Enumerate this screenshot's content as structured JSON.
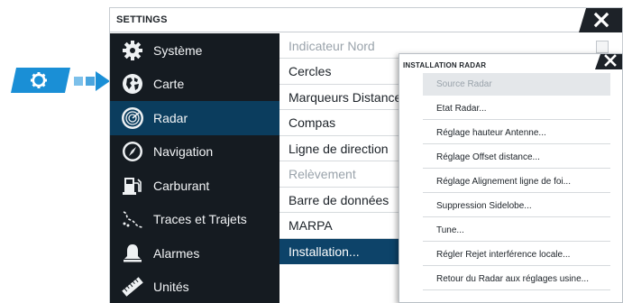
{
  "colors": {
    "accent_blue": "#1a8fd6",
    "sidebar_bg": "#151b21",
    "sidebar_selected": "#0b3d5e",
    "list_active": "#0d4369",
    "close_bg": "#1d2228"
  },
  "badge": {
    "icon": "gear-icon",
    "arrow": "arrow-right-icon"
  },
  "settings": {
    "title": "SETTINGS",
    "close_icon": "close-icon",
    "sidebar": [
      {
        "label": "Système",
        "icon": "gear-icon"
      },
      {
        "label": "Carte",
        "icon": "chart-globe-icon"
      },
      {
        "label": "Radar",
        "icon": "radar-icon",
        "selected": true
      },
      {
        "label": "Navigation",
        "icon": "compass-icon"
      },
      {
        "label": "Carburant",
        "icon": "fuel-pump-icon"
      },
      {
        "label": "Traces et Trajets",
        "icon": "trails-icon"
      },
      {
        "label": "Alarmes",
        "icon": "bell-icon"
      },
      {
        "label": "Unités",
        "icon": "ruler-icon"
      }
    ],
    "radar_options": [
      {
        "label": "Indicateur Nord",
        "disabled": true
      },
      {
        "label": "Cercles"
      },
      {
        "label": "Marqueurs Distance"
      },
      {
        "label": "Compas"
      },
      {
        "label": "Ligne de direction"
      },
      {
        "label": "Relèvement",
        "disabled": true
      },
      {
        "label": "Barre de données"
      },
      {
        "label": "MARPA"
      },
      {
        "label": "Installation...",
        "active": true
      }
    ]
  },
  "popup": {
    "title": "INSTALLATION RADAR",
    "close_icon": "close-icon",
    "items": [
      {
        "label": "Source Radar",
        "highlight": true
      },
      {
        "label": "Etat Radar..."
      },
      {
        "label": "Réglage hauteur Antenne..."
      },
      {
        "label": "Réglage Offset distance..."
      },
      {
        "label": "Réglage Alignement ligne de foi..."
      },
      {
        "label": "Suppression Sidelobe..."
      },
      {
        "label": "Tune..."
      },
      {
        "label": "Régler Rejet interférence locale..."
      },
      {
        "label": "Retour du Radar aux réglages usine..."
      }
    ]
  }
}
